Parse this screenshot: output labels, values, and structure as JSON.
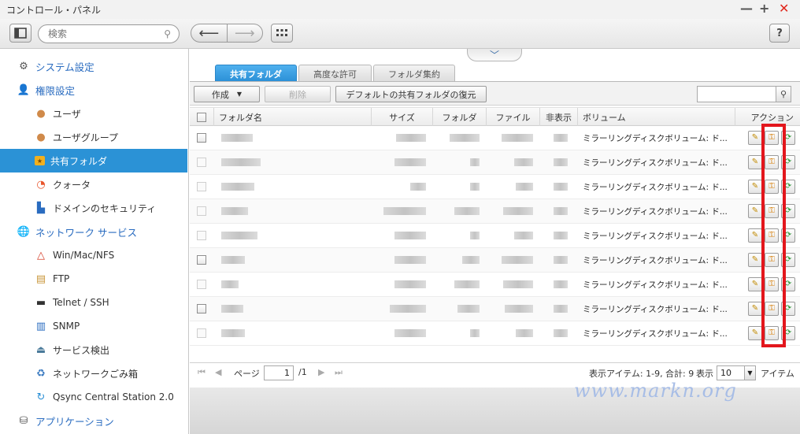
{
  "window": {
    "title": "コントロール・パネル"
  },
  "toolbar": {
    "search_placeholder": "検索",
    "help_label": "?"
  },
  "sidebar": {
    "items": [
      {
        "label": "システム設定",
        "icon": "gear-icon"
      },
      {
        "label": "権限設定",
        "icon": "user-icon"
      },
      {
        "label": "ユーザ",
        "icon": "user-icon"
      },
      {
        "label": "ユーザグループ",
        "icon": "group-icon"
      },
      {
        "label": "共有フォルダ",
        "icon": "folder-icon"
      },
      {
        "label": "クォータ",
        "icon": "pie-icon"
      },
      {
        "label": "ドメインのセキュリティ",
        "icon": "domain-icon"
      },
      {
        "label": "ネットワーク サービス",
        "icon": "globe-icon"
      },
      {
        "label": "Win/Mac/NFS",
        "icon": "triangle-icon"
      },
      {
        "label": "FTP",
        "icon": "ftp-icon"
      },
      {
        "label": "Telnet / SSH",
        "icon": "terminal-icon"
      },
      {
        "label": "SNMP",
        "icon": "bars-icon"
      },
      {
        "label": "サービス検出",
        "icon": "discovery-icon"
      },
      {
        "label": "ネットワークごみ箱",
        "icon": "recycle-icon"
      },
      {
        "label": "Qsync Central Station 2.0",
        "icon": "sync-icon"
      },
      {
        "label": "アプリケーション",
        "icon": "app-icon"
      }
    ]
  },
  "tabs": [
    {
      "label": "共有フォルダ"
    },
    {
      "label": "高度な許可"
    },
    {
      "label": "フォルダ集約"
    }
  ],
  "actions": {
    "create": "作成",
    "delete": "削除",
    "restore": "デフォルトの共有フォルダの復元"
  },
  "table": {
    "columns": [
      "フォルダ名",
      "サイズ",
      "フォルダ",
      "ファイル",
      "非表示",
      "ボリューム",
      "アクション"
    ],
    "volume_text": "ミラーリングディスクボリューム: ド...",
    "row_count": 9
  },
  "pager": {
    "page_label": "ページ",
    "page_value": "1",
    "page_total": "/1",
    "summary": "表示アイテム: 1-9, 合計: 9",
    "show_label": "表示",
    "show_value": "10",
    "items_label": "アイテム"
  },
  "watermark": "www.markn.org",
  "colors": {
    "accent": "#2b92d6",
    "highlight": "#e3161c"
  }
}
